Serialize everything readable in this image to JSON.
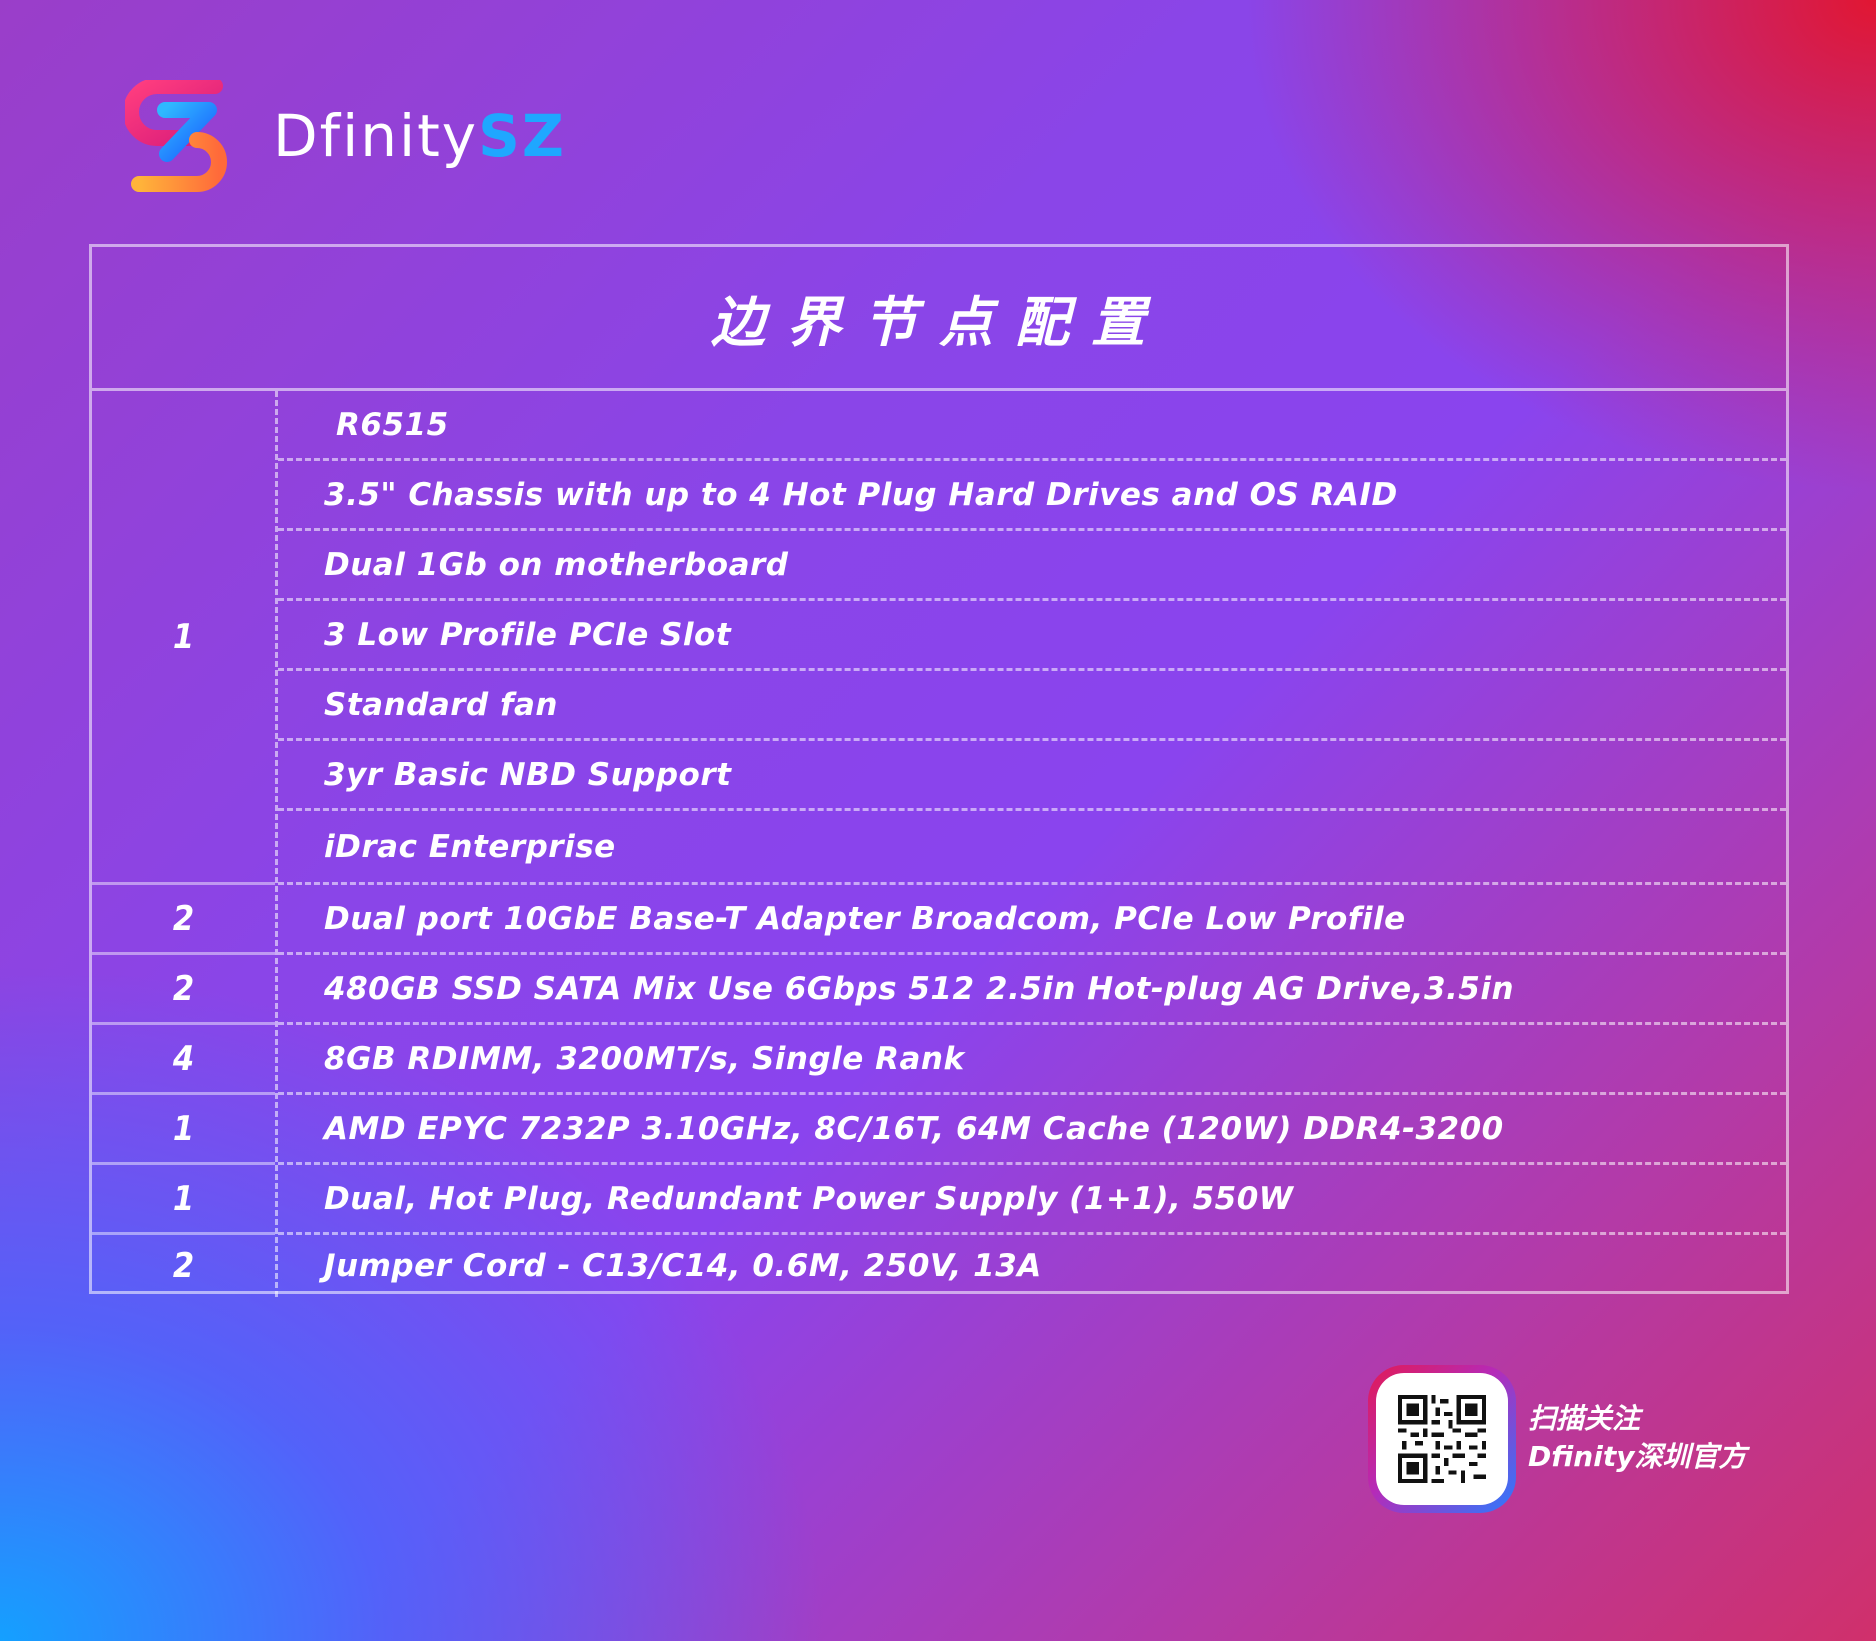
{
  "brand": {
    "name_prefix": "Dfinity",
    "name_suffix": "SZ"
  },
  "table": {
    "title": "边界节点配置",
    "rows": [
      {
        "qty": "1",
        "items": [
          "R6515",
          "3.5\" Chassis with up to 4 Hot Plug Hard Drives and OS RAID",
          "Dual 1Gb on motherboard",
          "3 Low Profile PCIe Slot",
          "Standard fan",
          "3yr Basic NBD Support",
          "iDrac Enterprise"
        ]
      },
      {
        "qty": "2",
        "items": [
          "Dual port 10GbE Base-T Adapter Broadcom, PCIe Low Profile"
        ]
      },
      {
        "qty": "2",
        "items": [
          "480GB SSD SATA Mix Use 6Gbps 512 2.5in Hot-plug AG Drive,3.5in"
        ]
      },
      {
        "qty": "4",
        "items": [
          "8GB RDIMM, 3200MT/s, Single Rank"
        ]
      },
      {
        "qty": "1",
        "items": [
          "AMD EPYC 7232P 3.10GHz, 8C/16T, 64M Cache (120W) DDR4-3200"
        ]
      },
      {
        "qty": "1",
        "items": [
          "Dual, Hot Plug, Redundant Power Supply (1+1), 550W"
        ]
      },
      {
        "qty": "2",
        "items": [
          "Jumper Cord - C13/C14, 0.6M, 250V, 13A"
        ]
      }
    ]
  },
  "qr": {
    "caption_line1": "扫描关注",
    "caption_line2": "Dfinity深圳官方"
  },
  "colors": {
    "brand_accent": "#1fa7ff",
    "qr_border_start": "#e21a55",
    "qr_border_end": "#2a7bff"
  }
}
